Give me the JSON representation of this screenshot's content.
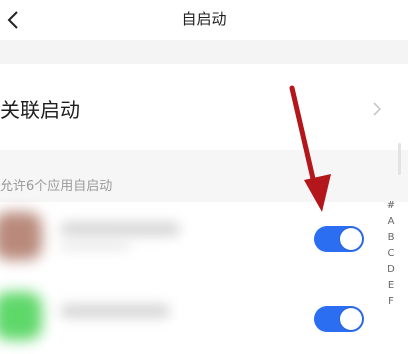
{
  "header": {
    "title": "自启动",
    "back_icon": "chevron-left-icon"
  },
  "associated_start": {
    "label": "关联启动",
    "chevron_icon": "chevron-right-icon"
  },
  "section": {
    "caption": "允许6个应用自启动"
  },
  "apps": [
    {
      "icon_color": "#b98a7c",
      "enabled": true
    },
    {
      "icon_color": "#5fd86a",
      "enabled": true
    }
  ],
  "index_letters": [
    "#",
    "A",
    "B",
    "C",
    "D",
    "E",
    "F"
  ],
  "colors": {
    "toggle_on": "#2b6ef2",
    "arrow": "#b3161b"
  }
}
